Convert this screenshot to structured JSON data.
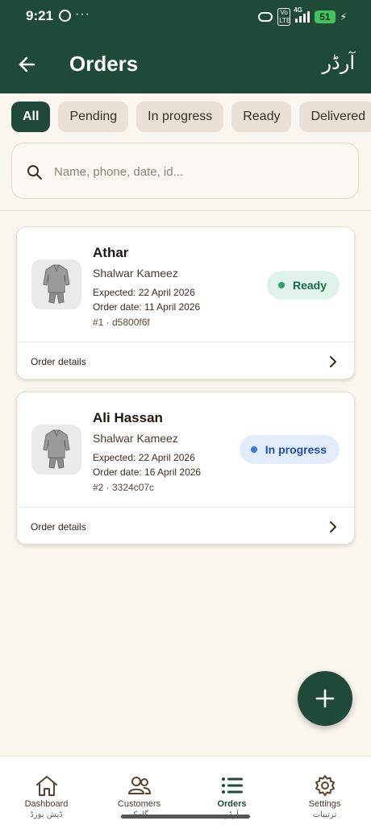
{
  "status_bar": {
    "time": "9:21",
    "dots": "···",
    "volte": "Vo LTE",
    "network": "4G",
    "battery": "51"
  },
  "header": {
    "title": "Orders",
    "title_urdu": "آرڈر"
  },
  "filters": [
    {
      "label": "All",
      "active": true
    },
    {
      "label": "Pending",
      "active": false
    },
    {
      "label": "In progress",
      "active": false
    },
    {
      "label": "Ready",
      "active": false
    },
    {
      "label": "Delivered",
      "active": false
    }
  ],
  "search": {
    "placeholder": "Name, phone, date, id...",
    "value": ""
  },
  "orders": [
    {
      "customer": "Athar",
      "garment": "Shalwar Kameez",
      "expected": "Expected: 22 April 2026",
      "order_date": "Order date: 11 April 2026",
      "id_line": "#1 · d5800f6f",
      "status": "Ready",
      "details_label": "Order details"
    },
    {
      "customer": "Ali Hassan",
      "garment": "Shalwar Kameez",
      "expected": "Expected: 22 April 2026",
      "order_date": "Order date: 16 April 2026",
      "id_line": "#2 · 3324c07c",
      "status": "In progress",
      "details_label": "Order details"
    }
  ],
  "bottom_nav": [
    {
      "label": "Dashboard",
      "urdu": "ڈیش بورڈ",
      "icon": "home-icon"
    },
    {
      "label": "Customers",
      "urdu": "گاہک",
      "icon": "people-icon"
    },
    {
      "label": "Orders",
      "urdu": "آرڈر",
      "icon": "list-icon",
      "active": true
    },
    {
      "label": "Settings",
      "urdu": "ترتیبات",
      "icon": "gear-icon"
    }
  ],
  "colors": {
    "primary": "#1e4a37",
    "background": "#fbf5ef",
    "ready": "#27a46c",
    "in_progress": "#3b78e7"
  }
}
